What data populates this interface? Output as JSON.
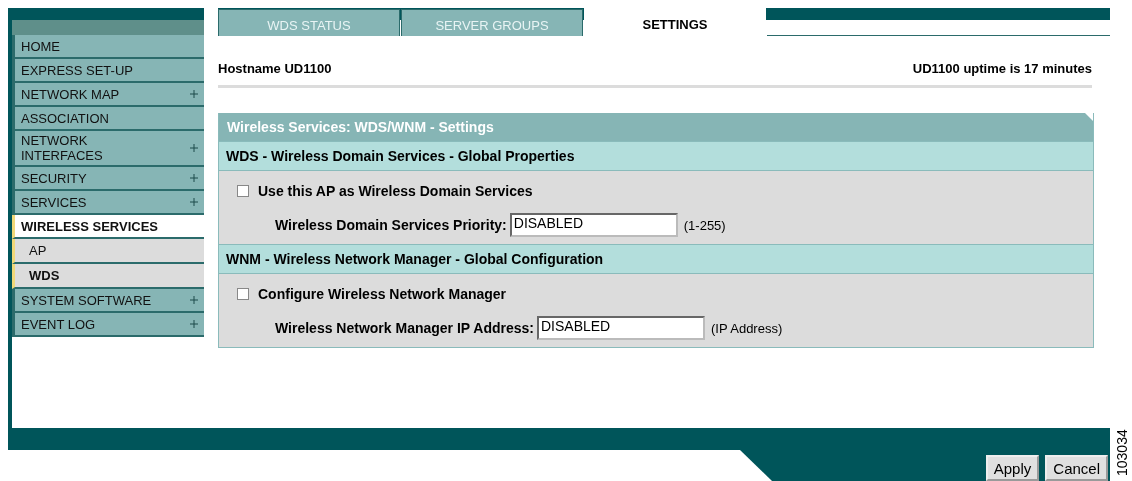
{
  "nav": [
    {
      "label": "HOME",
      "expandable": false,
      "selected": false
    },
    {
      "label": "EXPRESS SET-UP",
      "expandable": false,
      "selected": false
    },
    {
      "label": "NETWORK MAP",
      "expandable": true,
      "selected": false
    },
    {
      "label": "ASSOCIATION",
      "expandable": false,
      "selected": false
    },
    {
      "label": "NETWORK INTERFACES",
      "expandable": true,
      "selected": false
    },
    {
      "label": "SECURITY",
      "expandable": true,
      "selected": false
    },
    {
      "label": "SERVICES",
      "expandable": true,
      "selected": false
    },
    {
      "label": "WIRELESS SERVICES",
      "expandable": false,
      "expanded": true,
      "selected": true,
      "children": [
        {
          "label": "AP",
          "selected": false
        },
        {
          "label": "WDS",
          "selected": true
        }
      ]
    },
    {
      "label": "SYSTEM SOFTWARE",
      "expandable": true,
      "selected": false
    },
    {
      "label": "EVENT LOG",
      "expandable": true,
      "selected": false
    }
  ],
  "tabs": [
    {
      "label": "WDS STATUS",
      "selected": false
    },
    {
      "label": "SERVER GROUPS",
      "selected": false
    },
    {
      "label": "SETTINGS",
      "selected": true
    }
  ],
  "hostname": "Hostname  UD1100",
  "uptime": "UD1100 uptime is 17 minutes",
  "panel": {
    "title": "Wireless Services: WDS/WNM - Settings",
    "sections": [
      {
        "heading": "WDS - Wireless Domain Services - Global Properties",
        "checkbox": {
          "label": "Use this AP as Wireless Domain Services",
          "checked": false
        },
        "field": {
          "label": "Wireless Domain Services Priority:",
          "value": "DISABLED",
          "hint": "(1-255)"
        }
      },
      {
        "heading": "WNM - Wireless Network Manager - Global Configuration",
        "checkbox": {
          "label": "Configure Wireless Network Manager",
          "checked": false
        },
        "field": {
          "label": "Wireless Network Manager IP Address:",
          "value": "DISABLED",
          "hint": "(IP Address)"
        }
      }
    ]
  },
  "buttons": [
    "Apply",
    "Cancel"
  ],
  "figure_id": "103034"
}
